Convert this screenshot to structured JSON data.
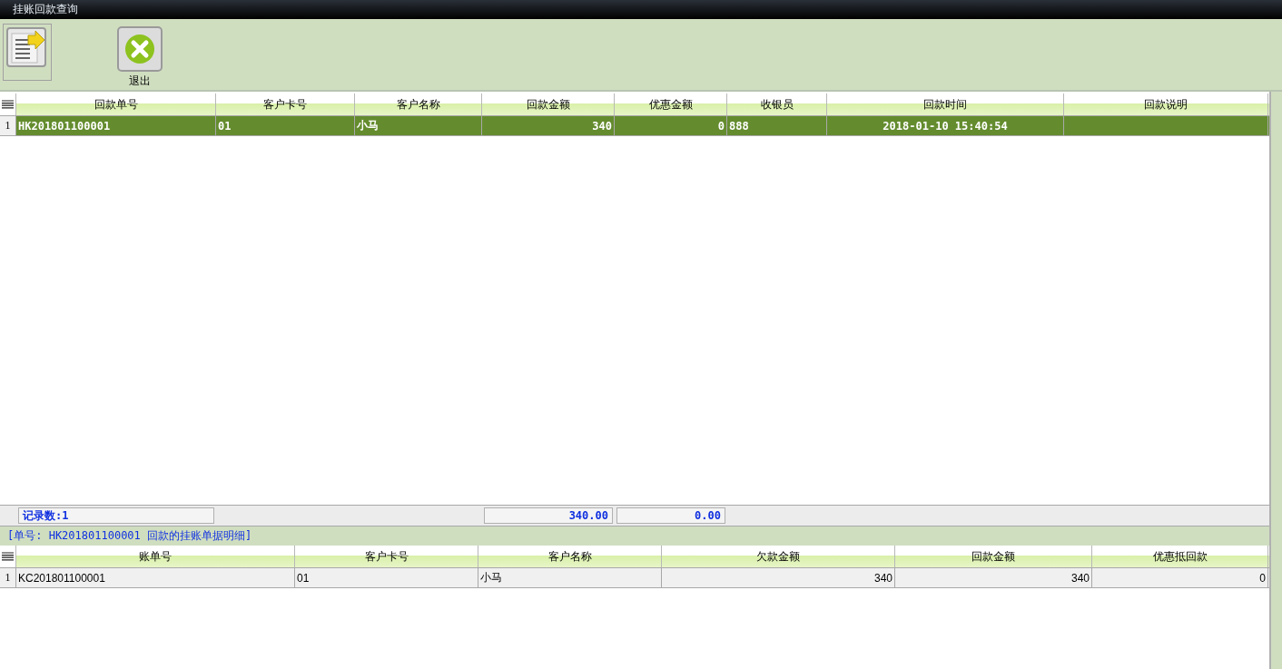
{
  "window": {
    "title": "挂账回款查询"
  },
  "toolbar": [
    {
      "kind": "export"
    },
    {
      "label": "退出",
      "kind": "exit"
    }
  ],
  "main_table": {
    "columns": [
      "回款单号",
      "客户卡号",
      "客户名称",
      "回款金额",
      "优惠金额",
      "收银员",
      "回款时间",
      "回款说明"
    ],
    "rows": [
      {
        "number": "1",
        "selected": true,
        "cells": [
          "HK201801100001",
          "01",
          "小马",
          "340",
          "0",
          "888",
          "2018-01-10 15:40:54",
          ""
        ]
      }
    ],
    "summary": {
      "count": "记录数:1",
      "total_amount": "340.00",
      "total_discount": "0.00"
    }
  },
  "detail_caption": "[单号: HK201801100001 回款的挂账单据明细]",
  "detail_table": {
    "columns": [
      "账单号",
      "客户卡号",
      "客户名称",
      "欠款金额",
      "回款金额",
      "优惠抵回款"
    ],
    "rows": [
      {
        "number": "1",
        "selected": false,
        "cells": [
          "KC201801100001",
          "01",
          "小马",
          "340",
          "340",
          "0"
        ]
      }
    ]
  }
}
